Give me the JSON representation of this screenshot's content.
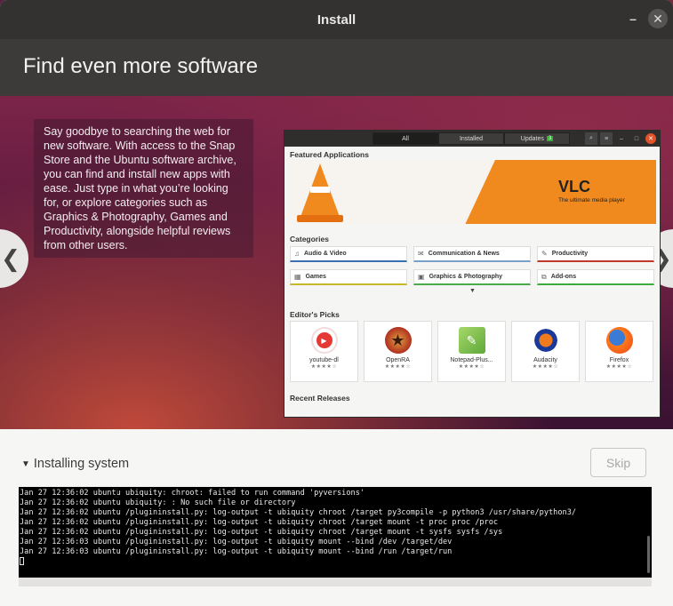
{
  "window": {
    "title": "Install"
  },
  "banner": {
    "heading": "Find even more software"
  },
  "slide": {
    "description": "Say goodbye to searching the web for new software. With access to the Snap Store and the Ubuntu software archive, you can find and install new apps with ease. Just type in what you’re looking for, or explore categories such as Graphics & Photography, Games and Productivity, alongside helpful reviews from other users.",
    "prev_glyph": "❮",
    "next_glyph": "❯"
  },
  "software_center": {
    "tabs": [
      "All",
      "Installed",
      "Updates"
    ],
    "updates_count": "3",
    "featured_label": "Featured Applications",
    "featured_app": {
      "name": "VLC",
      "tagline": "The ultimate media player"
    },
    "categories_label": "Categories",
    "categories": [
      {
        "label": "Audio & Video",
        "icon": "♫",
        "color": "#3a6fb0"
      },
      {
        "label": "Communication & News",
        "icon": "✉",
        "color": "#7a9fc8"
      },
      {
        "label": "Productivity",
        "icon": "✎",
        "color": "#c0392b"
      },
      {
        "label": "Games",
        "icon": "▦",
        "color": "#c9b62a"
      },
      {
        "label": "Graphics & Photography",
        "icon": "▣",
        "color": "#4caa4c"
      },
      {
        "label": "Add-ons",
        "icon": "⧉",
        "color": "#3cab3c"
      }
    ],
    "editors_picks_label": "Editor's Picks",
    "editors_picks": [
      {
        "name": "youtube-dl",
        "stars": "★★★★☆"
      },
      {
        "name": "OpenRA",
        "stars": "★★★★☆"
      },
      {
        "name": "Notepad-Plus...",
        "stars": "★★★★☆"
      },
      {
        "name": "Audacity",
        "stars": "★★★★☆"
      },
      {
        "name": "Firefox",
        "stars": "★★★★☆"
      }
    ],
    "recent_releases_label": "Recent Releases"
  },
  "install": {
    "section_label": "Installing system",
    "skip_label": "Skip",
    "log_lines": [
      "Jan 27 12:36:02 ubuntu ubiquity: chroot: failed to run command 'pyversions'",
      "Jan 27 12:36:02 ubuntu ubiquity: : No such file or directory",
      "Jan 27 12:36:02 ubuntu /plugininstall.py: log-output -t ubiquity chroot /target py3compile -p python3 /usr/share/python3/",
      "Jan 27 12:36:02 ubuntu /plugininstall.py: log-output -t ubiquity chroot /target mount -t proc proc /proc",
      "Jan 27 12:36:02 ubuntu /plugininstall.py: log-output -t ubiquity chroot /target mount -t sysfs sysfs /sys",
      "Jan 27 12:36:03 ubuntu /plugininstall.py: log-output -t ubiquity mount --bind /dev /target/dev",
      "Jan 27 12:36:03 ubuntu /plugininstall.py: log-output -t ubiquity mount --bind /run /target/run"
    ]
  }
}
